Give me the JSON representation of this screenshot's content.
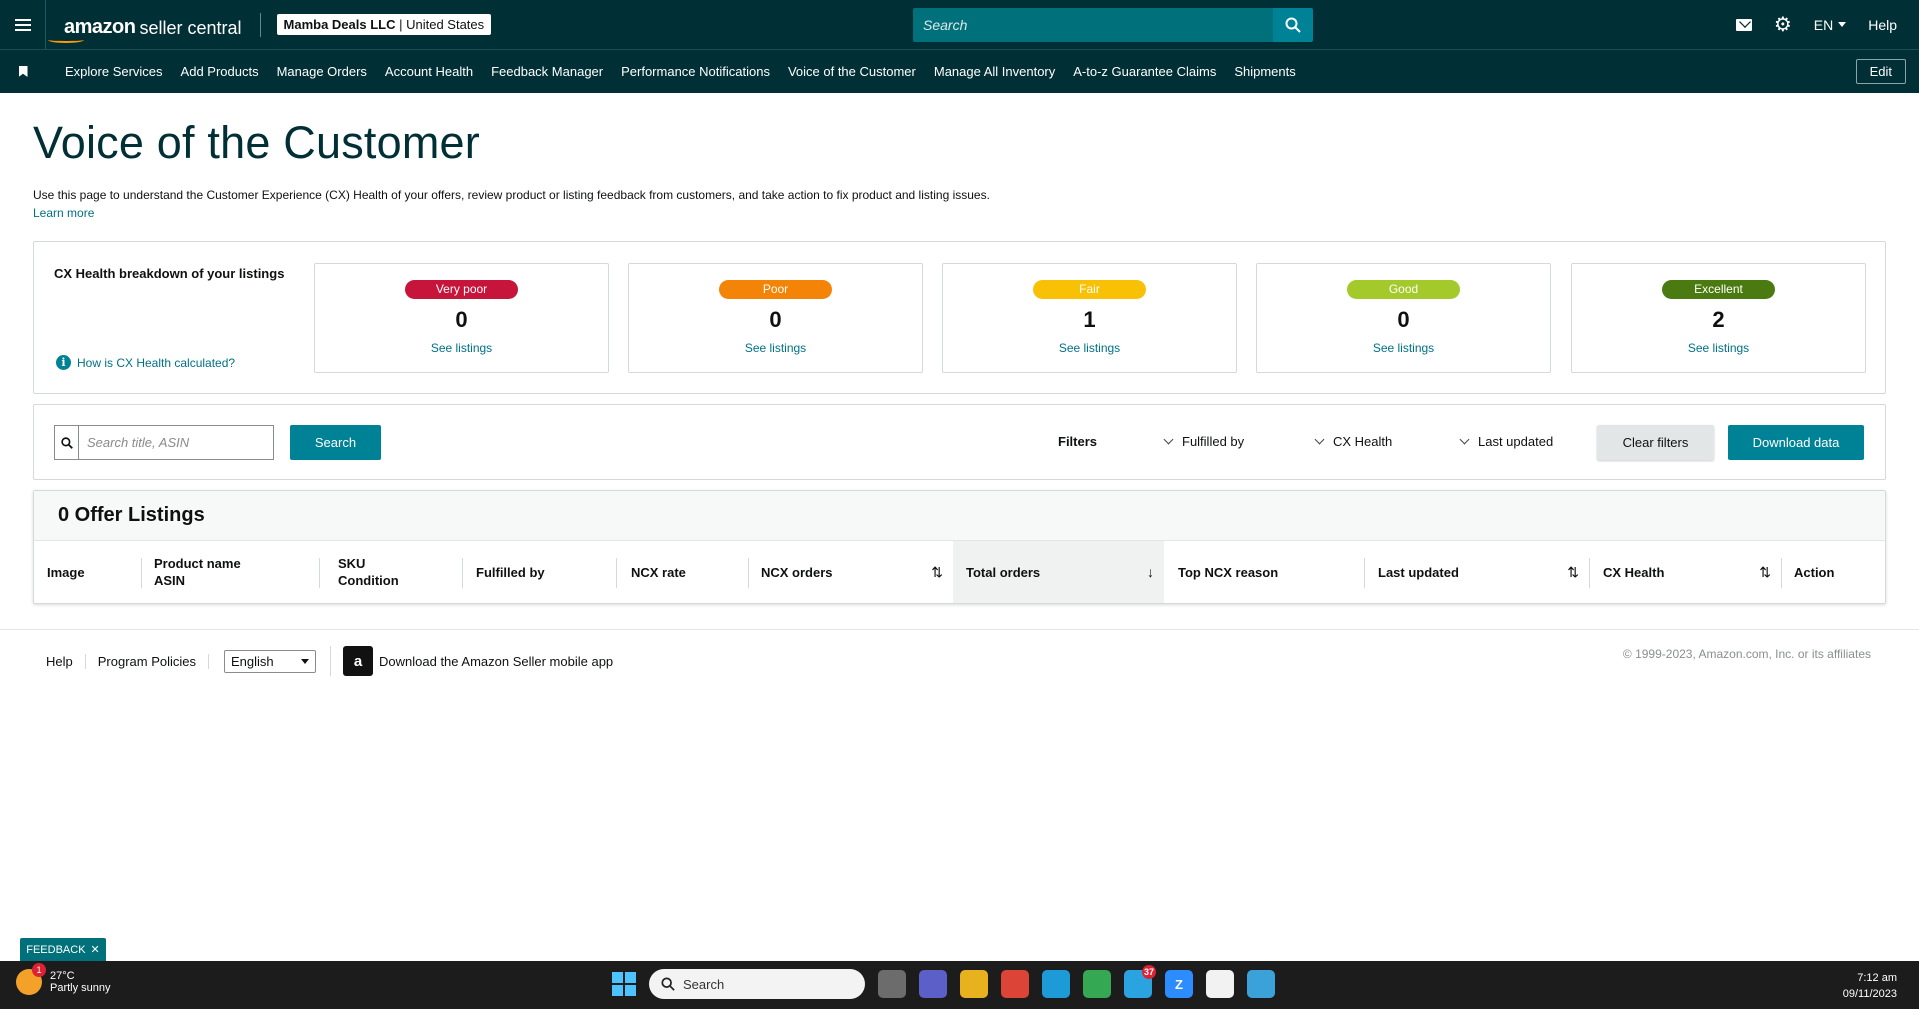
{
  "topbar": {
    "brand_amazon": "amazon",
    "brand_sc": "seller central",
    "account_name": "Mamba Deals LLC",
    "account_sep": " | ",
    "account_region": "United States",
    "search_placeholder": "Search",
    "lang": "EN",
    "help": "Help"
  },
  "nav": {
    "items": [
      "Explore Services",
      "Add Products",
      "Manage Orders",
      "Account Health",
      "Feedback Manager",
      "Performance Notifications",
      "Voice of the Customer",
      "Manage All Inventory",
      "A-to-z Guarantee Claims",
      "Shipments"
    ],
    "edit": "Edit"
  },
  "page": {
    "title": "Voice of the Customer",
    "description": "Use this page to understand the Customer Experience (CX) Health of your offers, review product or listing feedback from customers, and take action to fix product and listing issues.",
    "learn_more": "Learn more"
  },
  "cx": {
    "title": "CX Health breakdown of your listings",
    "help_link": "How is CX Health calculated?",
    "cards": [
      {
        "label": "Very poor",
        "count": "0",
        "link": "See listings",
        "color": "#c7143b"
      },
      {
        "label": "Poor",
        "count": "0",
        "link": "See listings",
        "color": "#f38407"
      },
      {
        "label": "Fair",
        "count": "1",
        "link": "See listings",
        "color": "#f9c105"
      },
      {
        "label": "Good",
        "count": "0",
        "link": "See listings",
        "color": "#a4c92b"
      },
      {
        "label": "Excellent",
        "count": "2",
        "link": "See listings",
        "color": "#4b7b10"
      }
    ]
  },
  "filters": {
    "search_placeholder": "Search title, ASIN",
    "search_button": "Search",
    "label": "Filters",
    "fulfilled_by": "Fulfilled by",
    "cx_health": "CX Health",
    "last_updated": "Last updated",
    "clear": "Clear filters",
    "download": "Download data"
  },
  "table": {
    "title": "0 Offer Listings",
    "columns": {
      "image": "Image",
      "product_name": "Product name",
      "asin": "ASIN",
      "sku": "SKU",
      "condition": "Condition",
      "fulfilled_by": "Fulfilled by",
      "ncx_rate": "NCX rate",
      "ncx_orders": "NCX orders",
      "total_orders": "Total orders",
      "top_ncx_reason": "Top NCX reason",
      "last_updated": "Last updated",
      "cx_health": "CX Health",
      "action": "Action"
    }
  },
  "footer": {
    "help": "Help",
    "program_policies": "Program Policies",
    "language": "English",
    "app": "Download the Amazon Seller mobile app",
    "copyright": "© 1999-2023, Amazon.com, Inc. or its affiliates"
  },
  "feedback": "FEEDBACK",
  "taskbar": {
    "weather_badge": "1",
    "temp": "27°C",
    "weather": "Partly sunny",
    "search": "Search",
    "telegram_badge": "37",
    "time": "7:12 am",
    "date": "09/11/2023"
  }
}
